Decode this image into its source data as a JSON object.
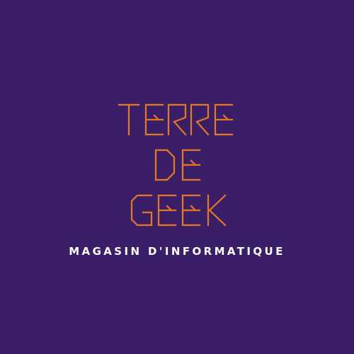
{
  "logo": {
    "lines": [
      "TERRE",
      "DE",
      "GEEK"
    ],
    "tagline": "MAGASIN D'INFORMATIQUE"
  },
  "colors": {
    "background": "#3a1f68",
    "accent": "#e87722",
    "tagline": "#ffffff"
  }
}
